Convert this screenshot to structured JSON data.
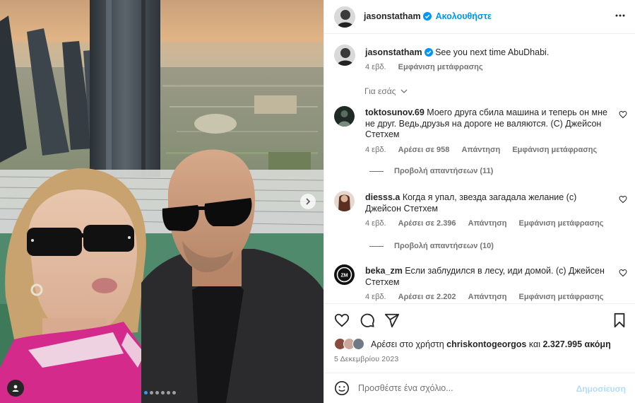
{
  "header": {
    "username": "jasonstatham",
    "follow_label": "Ακολουθήστε"
  },
  "caption": {
    "username": "jasonstatham",
    "text": "See you next time AbuDhabi.",
    "time": "4 εβδ.",
    "translate_label": "Εμφάνιση μετάφρασης"
  },
  "for_you_label": "Για εσάς",
  "comments": [
    {
      "username": "toktosunov.69",
      "text": "Моего друга сбила машина и теперь он мне не друг. Ведь,друзья на дороге не валяются. (С) Джейсон Стетхем",
      "time": "4 εβδ.",
      "likes": "Αρέσει σε 958",
      "reply": "Απάντηση",
      "translate": "Εμφάνιση μετάφρασης",
      "view_replies": "Προβολή απαντήσεων (11)"
    },
    {
      "username": "diesss.a",
      "text": "Когда я упал, звезда загадала желание (с) Джейсон Стетхем",
      "time": "4 εβδ.",
      "likes": "Αρέσει σε 2.396",
      "reply": "Απάντηση",
      "translate": "Εμφάνιση μετάφρασης",
      "view_replies": "Προβολή απαντήσεων (10)"
    },
    {
      "username": "beka_zm",
      "text": "Если заблудился в лесу, иди домой. (с) Джейсен Стетхем",
      "time": "4 εβδ.",
      "likes": "Αρέσει σε 2.202",
      "reply": "Απάντηση",
      "translate": "Εμφάνιση μετάφρασης"
    }
  ],
  "likes": {
    "prefix": "Αρέσει στο χρήστη",
    "user": "chriskontogeorgos",
    "connector": "και",
    "count": "2.327.995 ακόμη"
  },
  "date": "5 Δεκεμβρίου 2023",
  "add_comment": {
    "placeholder": "Προσθέστε ένα σχόλιο...",
    "post_label": "Δημοσίευση"
  },
  "carousel": {
    "total": 6,
    "current": 1
  },
  "colors": {
    "accent": "#0095f6",
    "verified": "#0095f6",
    "post_disabled": "#b3dbff"
  },
  "icons": [
    "more-icon",
    "verified-icon",
    "heart-icon",
    "comment-icon",
    "share-icon",
    "bookmark-icon",
    "emoji-icon",
    "chevron-down-icon",
    "chevron-right-icon",
    "person-tag-icon"
  ]
}
